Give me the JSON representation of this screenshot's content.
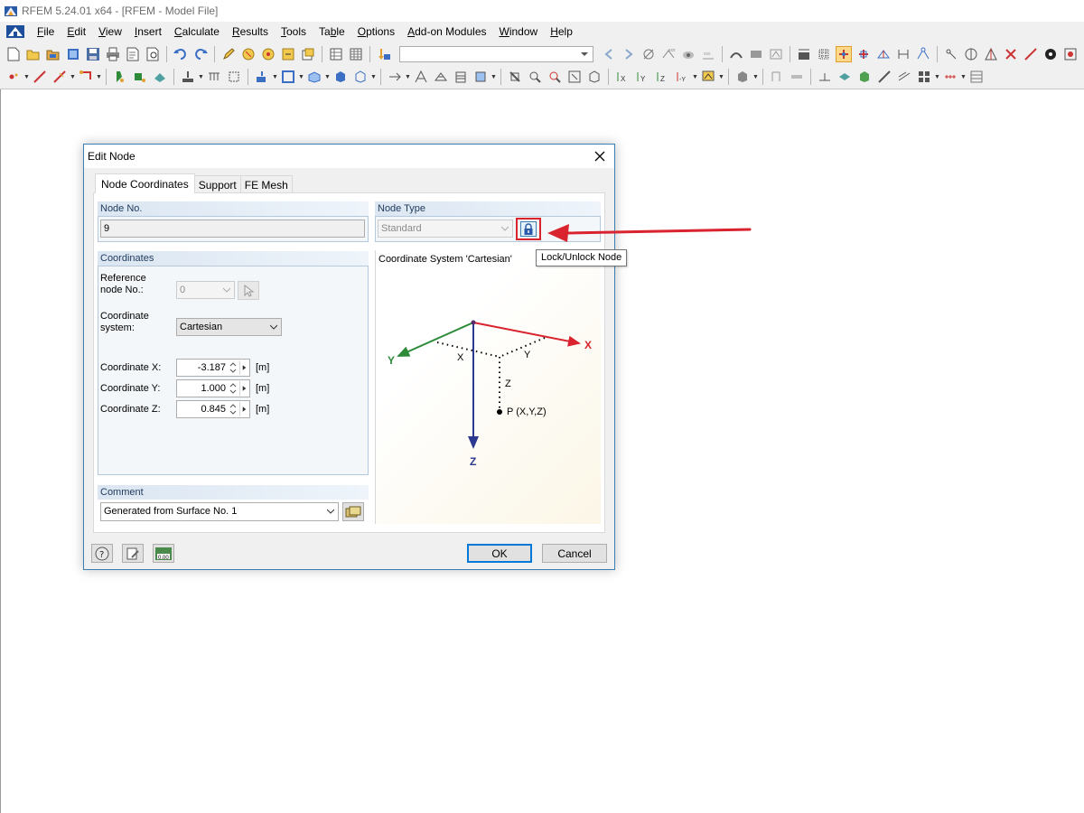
{
  "window": {
    "title": "RFEM 5.24.01 x64 - [RFEM - Model File]"
  },
  "menu": [
    {
      "label": "File",
      "accel": "F",
      "rest": "ile"
    },
    {
      "label": "Edit",
      "accel": "E",
      "rest": "dit"
    },
    {
      "label": "View",
      "accel": "V",
      "rest": "iew"
    },
    {
      "label": "Insert",
      "accel": "I",
      "rest": "nsert"
    },
    {
      "label": "Calculate",
      "accel": "C",
      "rest": "alculate"
    },
    {
      "label": "Results",
      "accel": "R",
      "rest": "esults"
    },
    {
      "label": "Tools",
      "accel": "T",
      "rest": "ools"
    },
    {
      "label": "Table",
      "pre": "Ta",
      "accel": "b",
      "rest": "le"
    },
    {
      "label": "Options",
      "accel": "O",
      "rest": "ptions"
    },
    {
      "label": "Add-on Modules",
      "accel": "A",
      "rest": "dd-on Modules"
    },
    {
      "label": "Window",
      "accel": "W",
      "rest": "indow"
    },
    {
      "label": "Help",
      "accel": "H",
      "rest": "elp"
    }
  ],
  "toolbar": {
    "combo_value": ""
  },
  "dialog": {
    "title": "Edit Node",
    "tabs": [
      "Node Coordinates",
      "Support",
      "FE Mesh"
    ],
    "active_tab": "Node Coordinates",
    "node_no": {
      "label": "Node No.",
      "value": "9"
    },
    "node_type": {
      "label": "Node Type",
      "value": "Standard"
    },
    "coordinates": {
      "label": "Coordinates",
      "reference_node_label_1": "Reference",
      "reference_node_label_2": "node No.:",
      "reference_node_value": "0",
      "coord_system_label_1": "Coordinate",
      "coord_system_label_2": "system:",
      "coord_system_value": "Cartesian",
      "x_label": "Coordinate X:",
      "x_value": "-3.187",
      "y_label": "Coordinate Y:",
      "y_value": "1.000",
      "z_label": "Coordinate Z:",
      "z_value": "0.845",
      "unit": "[m]"
    },
    "comment": {
      "label": "Comment",
      "value": "Generated from Surface No. 1"
    },
    "diagram": {
      "title": "Coordinate System 'Cartesian'",
      "axis_x": "X",
      "axis_y": "Y",
      "axis_z": "Z",
      "dim_x": "X",
      "dim_y": "Y",
      "dim_z": "Z",
      "point": "P (X,Y,Z)",
      "color_x": "#d9232e",
      "color_y": "#2e8b3a",
      "color_z": "#2b3990"
    },
    "tooltip": "Lock/Unlock Node",
    "ok_label": "OK",
    "cancel_label": "Cancel"
  },
  "colors": {
    "highlight_red": "#d9232e",
    "accent_blue": "#0078d7"
  }
}
